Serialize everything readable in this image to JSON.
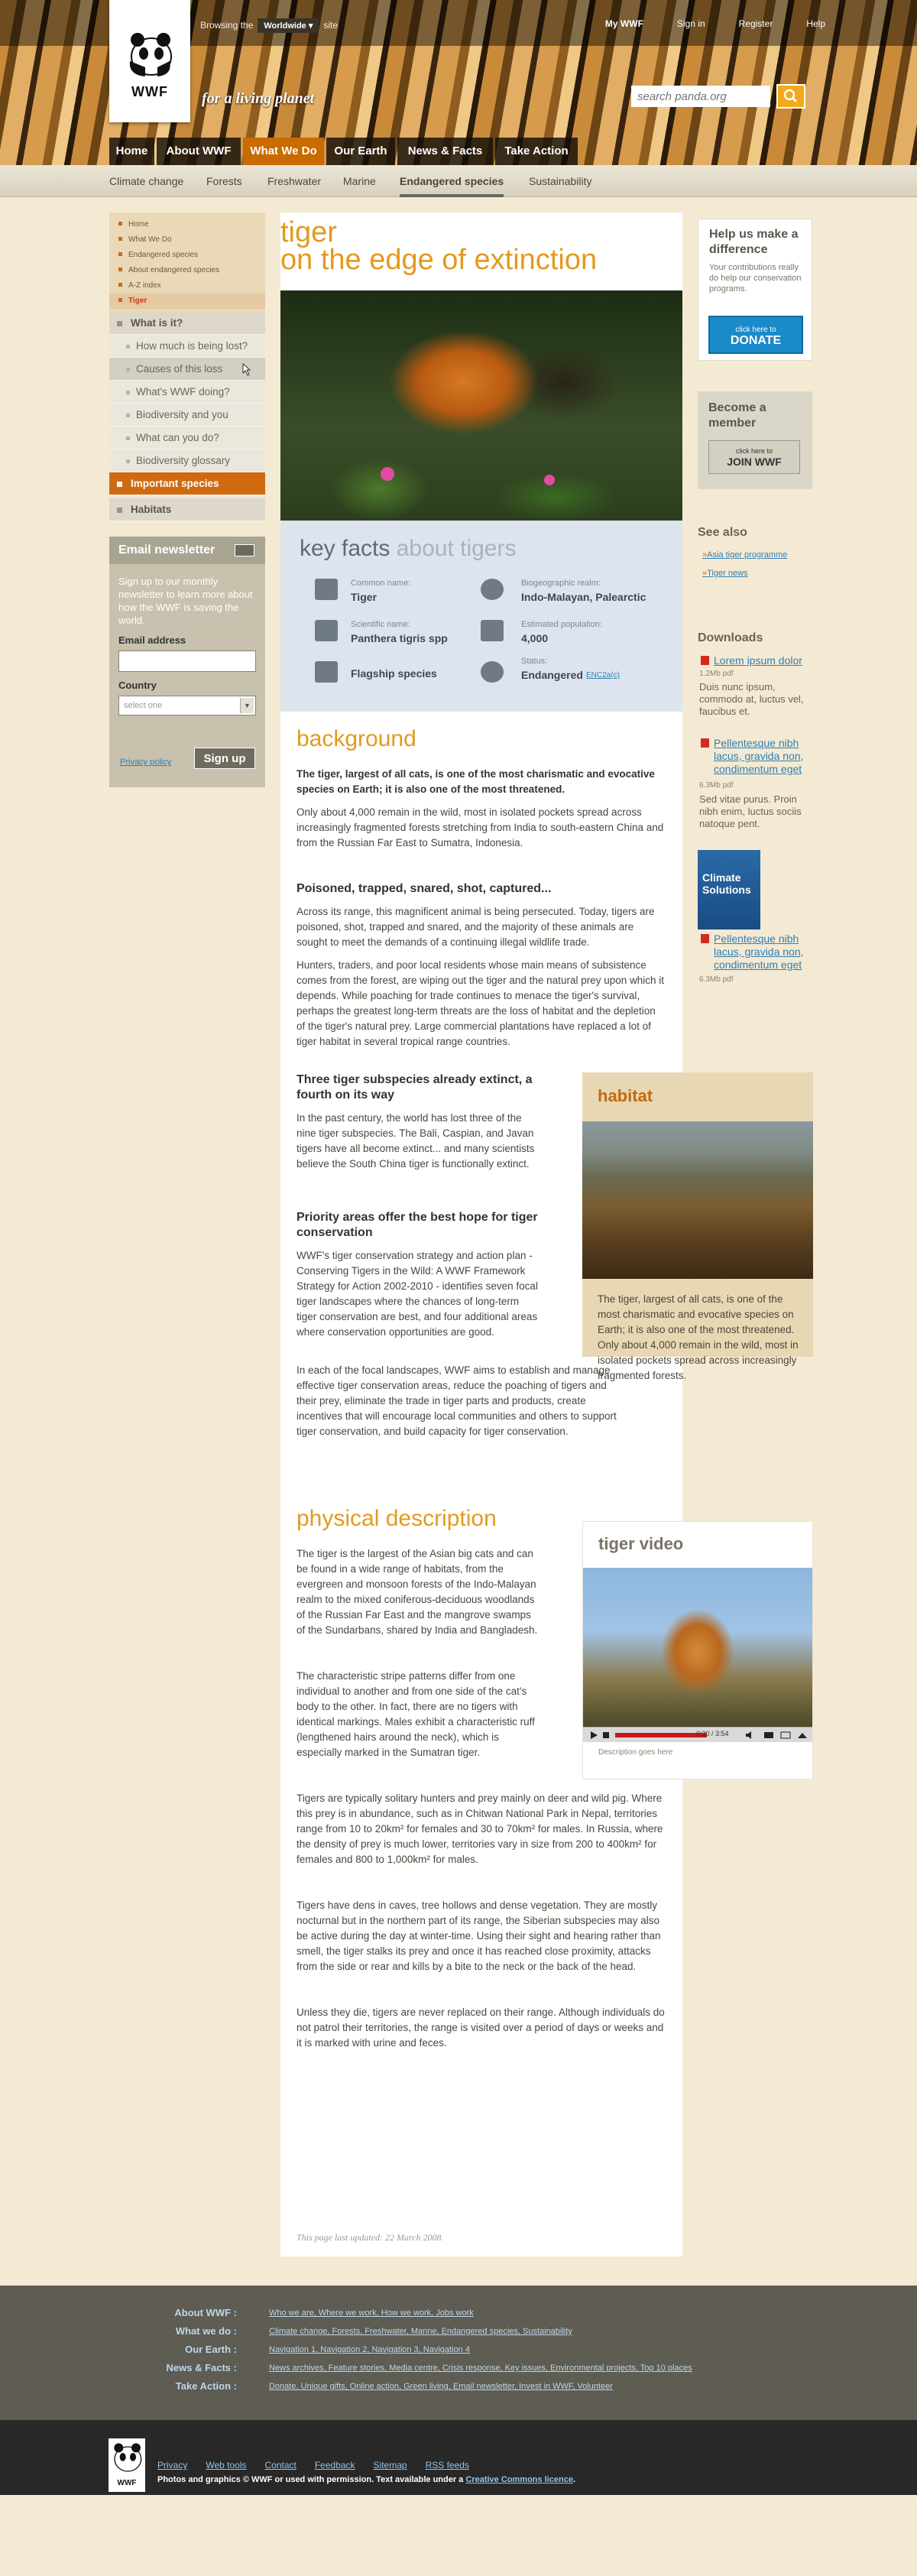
{
  "topbar": {
    "browsing": "Browsing the",
    "selected": "Worldwide",
    "site": "site",
    "links": [
      "My WWF",
      "Sign in",
      "Register",
      "Help"
    ]
  },
  "logo": {
    "text": "WWF"
  },
  "tagline": "for a living planet",
  "search": {
    "placeholder": "search panda.org"
  },
  "main_nav": [
    "Home",
    "About WWF",
    "What We Do",
    "Our Earth",
    "News & Facts",
    "Take Action"
  ],
  "sub_nav": [
    "Climate change",
    "Forests",
    "Freshwater",
    "Marine",
    "Endangered species",
    "Sustainability"
  ],
  "breadcrumbs": [
    "Home",
    "What We Do",
    "Endangered species",
    "About endangered species",
    "A-Z index",
    "Tiger"
  ],
  "side_menu": {
    "top": "What is it?",
    "items": [
      "How much is being lost?",
      "Causes of this loss",
      "What's WWF doing?",
      "Biodiversity and you",
      "What can you do?",
      "Biodiversity glossary"
    ],
    "important": "Important species",
    "habitats": "Habitats"
  },
  "newsletter": {
    "title": "Email newsletter",
    "text": "Sign up to our monthly newsletter to learn more about how the WWF is saving the world.",
    "email_label": "Email address",
    "country_label": "Country",
    "country_placeholder": "select one",
    "privacy": "Privacy policy",
    "button": "Sign up"
  },
  "page": {
    "title1": "tiger",
    "title2": "on the edge of extinction",
    "updated": "This page last updated: 22 March 2008."
  },
  "key_facts": {
    "title": "key facts",
    "title_sub": "about tigers",
    "items": [
      {
        "label": "Common name:",
        "value": "Tiger"
      },
      {
        "label": "Biogeographic realm:",
        "value": "Indo-Malayan, Palearctic"
      },
      {
        "label": "Scientific name:",
        "value": "Panthera tigris spp"
      },
      {
        "label": "Estimated population:",
        "value": "4,000"
      },
      {
        "label": "",
        "value": "Flagship species"
      },
      {
        "label": "Status:",
        "value": "Endangered"
      }
    ],
    "status_link": "ENC2a(c)"
  },
  "background": {
    "heading": "background",
    "lead": "The tiger, largest of all cats, is one of the most charismatic and evocative species on Earth; it is also one of the most threatened.",
    "p1": "Only about 4,000 remain in the wild, most in isolated pockets spread across increasingly fragmented forests stretching from India to south-eastern China and from the Russian Far East to Sumatra, Indonesia.",
    "sub1": "Poisoned, trapped, snared, shot, captured...",
    "p2": "Across its range, this magnificent animal is being persecuted. Today, tigers are poisoned, shot, trapped and snared, and the majority of these animals are sought to meet the demands of a continuing illegal wildlife trade.",
    "p3": "Hunters, traders, and poor local residents whose main means of subsistence comes from the forest, are wiping out the tiger and the natural prey upon which it depends. While poaching for trade continues to menace the tiger's survival, perhaps the greatest long-term threats are the loss of habitat and the depletion of the tiger's natural prey. Large commercial plantations have replaced a lot of tiger habitat in several tropical range countries.",
    "sub2": "Three tiger subspecies already extinct, a fourth on its way",
    "p4": "In the past century, the world has lost three of the nine tiger subspecies. The Bali, Caspian, and Javan tigers have all become extinct... and many scientists believe the South China tiger is functionally extinct.",
    "sub3": "Priority areas offer the best hope for tiger conservation",
    "p5": "WWF's tiger conservation strategy and action plan - Conserving Tigers in the Wild: A WWF Framework Strategy for Action 2002-2010 - identifies seven focal tiger landscapes where the chances of long-term tiger conservation are best, and four additional areas where conservation opportunities are good.",
    "p6": "In each of the focal landscapes, WWF aims to establish and manage effective tiger conservation areas, reduce the poaching of tigers and their prey, eliminate the trade in tiger parts and products, create incentives that will encourage local communities and others to support tiger conservation, and build capacity for tiger conservation."
  },
  "habitat": {
    "title": "habitat",
    "caption": "The tiger, largest of all cats, is one of the most charismatic and evocative species on Earth; it is also one of the most threatened. Only about 4,000 remain in the wild, most in isolated pockets spread across increasingly fragmented forests."
  },
  "physical": {
    "heading": "physical description",
    "p1": "The tiger is the largest of the Asian big cats and can be found in a wide range of habitats, from the evergreen and monsoon forests of the Indo-Malayan realm to the mixed coniferous-deciduous woodlands of the Russian Far East and the mangrove swamps of the Sundarbans, shared by India and Bangladesh.",
    "p2": "The characteristic stripe patterns differ from one individual to another and from one side of the cat's body to the other. In fact, there are no tigers with identical markings. Males exhibit a characteristic ruff (lengthened hairs around the neck), which is especially marked in the Sumatran tiger.",
    "p3": "Tigers are typically solitary hunters and prey mainly on deer and wild pig. Where this prey is in abundance, such as in Chitwan National Park in Nepal, territories range from 10 to 20km² for females and 30 to 70km² for males. In Russia, where the density of prey is much lower, territories vary in size from 200 to 400km² for females and 800 to 1,000km² for males.",
    "p4": "Tigers have dens in caves, tree hollows and dense vegetation. They are mostly nocturnal but in the northern part of its range, the Siberian subspecies may also be active during the day at winter-time. Using their sight and hearing rather than smell, the tiger stalks its prey and once it has reached close proximity, attacks from the side or rear and kills by a bite to the neck or the back of the head.",
    "p5": "Unless they die, tigers are never replaced on their range. Although individuals do not patrol their territories, the range is visited over a period of days or weeks and it is marked with urine and feces."
  },
  "video": {
    "title": "tiger video",
    "time": "0:30 / 3:54",
    "caption": "Description goes here"
  },
  "help": {
    "title": "Help us make a difference",
    "text": "Your contributions really do help our conservation programs.",
    "donate_top": "click here to",
    "donate": "DONATE"
  },
  "member": {
    "title": "Become a member",
    "join_top": "click here to",
    "join": "JOIN WWF"
  },
  "see_also": {
    "title": "See also",
    "links": [
      "Asia tiger programme",
      "Tiger news"
    ]
  },
  "downloads": {
    "title": "Downloads",
    "items": [
      {
        "link": "Lorem ipsum dolor",
        "meta": "1.2Mb pdf",
        "desc": "Duis nunc ipsum, commodo at, luctus vel, faucibus et."
      },
      {
        "link": "Pellentesque nibh lacus, gravida non, condimentum eget",
        "meta": "6.3Mb pdf",
        "desc": "Sed vitae purus. Proin nibh enim, luctus sociis natoque pent."
      },
      {
        "link": "Pellentesque nibh lacus, gravida non, condimentum eget",
        "meta": "6.3Mb pdf",
        "desc": ""
      }
    ],
    "cover_text": "Climate Solutions"
  },
  "footer": {
    "rows": [
      {
        "label": "About WWF",
        "links": "Who we are, Where we work, How we work, Jobs work"
      },
      {
        "label": "What we do",
        "links": "Climate change, Forests, Freshwater, Marine, Endangered species, Sustainability"
      },
      {
        "label": "Our Earth",
        "links": "Navigation 1, Navigation 2, Navigation 3, Navigation 4"
      },
      {
        "label": "News & Facts",
        "links": "News archives, Feature stories, Media centre, Crisis response, Key issues, Environmental projects, Top 10 places"
      },
      {
        "label": "Take Action",
        "links": "Donate, Unique gifts, Online action, Green living, Email newsletter, Invest in WWF, Volunteer"
      }
    ],
    "nav": [
      "Privacy",
      "Web tools",
      "Contact",
      "Feedback",
      "Sitemap",
      "RSS feeds"
    ],
    "copy": "Photos and graphics © WWF or used with permission. Text available under a",
    "copy_link": "Creative Commons licence",
    "logo": "WWF"
  },
  "colors": {
    "accent": "#e29a1d",
    "nav_active": "#c96b00",
    "page_bg": "#f4ead3",
    "donate": "#1a8ac9"
  }
}
